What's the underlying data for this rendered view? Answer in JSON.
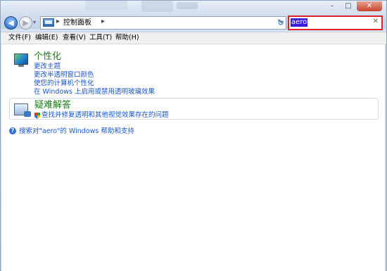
{
  "window": {
    "controls": {
      "minimize": "–",
      "maximize": "□",
      "close": "✕"
    }
  },
  "nav": {
    "back_icon": "back-arrow-icon",
    "forward_icon": "forward-arrow-icon",
    "recent_dropdown": "▾"
  },
  "address": {
    "icon": "control-panel-icon",
    "separator": "▸",
    "breadcrumb": "控制面板",
    "trailing_separator": "▸",
    "dropdown": "▾"
  },
  "refresh": {
    "glyph": "↻"
  },
  "search": {
    "value": "aero",
    "clear": "✕",
    "highlight_color": "#3b1cd6",
    "box_border_color": "#e0202a"
  },
  "menu": [
    {
      "label": "文件(F)"
    },
    {
      "label": "编辑(E)"
    },
    {
      "label": "查看(V)"
    },
    {
      "label": "工具(T)"
    },
    {
      "label": "帮助(H)"
    }
  ],
  "results": {
    "personalization": {
      "icon": "personalization-monitor-icon",
      "title": "个性化",
      "links": [
        "更改主题",
        "更改半透明窗口颜色",
        "使您的计算机个性化",
        "在 Windows 上启用或禁用透明玻璃效果"
      ]
    },
    "troubleshooting": {
      "icon": "troubleshooting-icon",
      "title": "疑难解答",
      "links": [
        "查找并修复透明和其他视觉效果存在的问题"
      ]
    }
  },
  "help": {
    "text": "搜索对\"aero\"的 Windows 帮助和支持"
  }
}
